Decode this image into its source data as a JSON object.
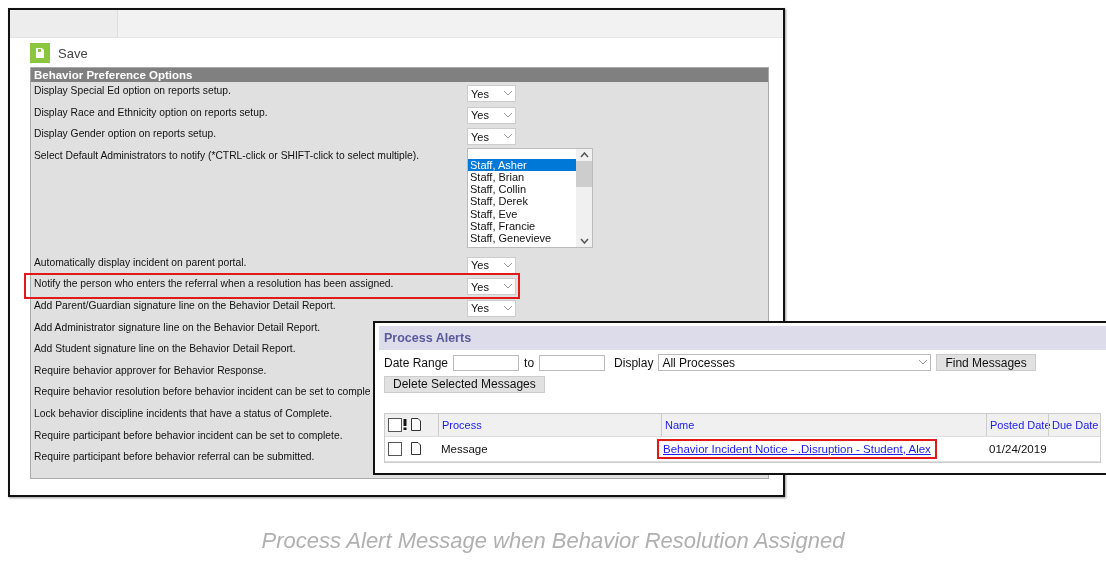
{
  "toolbar": {
    "save_label": "Save"
  },
  "panel": {
    "title": "Behavior Preference Options",
    "rows": [
      {
        "kind": "select",
        "label": "Display Special Ed option on reports setup.",
        "value": "Yes",
        "highlighted": false
      },
      {
        "kind": "select",
        "label": "Display Race and Ethnicity option on reports setup.",
        "value": "Yes",
        "highlighted": false
      },
      {
        "kind": "select",
        "label": "Display Gender option on reports setup.",
        "value": "Yes",
        "highlighted": false
      },
      {
        "kind": "listbox",
        "label": "Select Default Administrators to notify (*CTRL-click or SHIFT-click to select multiple).",
        "highlighted": false,
        "options": [
          {
            "label": "Staff, Asher",
            "selected": true
          },
          {
            "label": "Staff, Brian",
            "selected": false
          },
          {
            "label": "Staff, Collin",
            "selected": false
          },
          {
            "label": "Staff, Derek",
            "selected": false
          },
          {
            "label": "Staff, Eve",
            "selected": false
          },
          {
            "label": "Staff, Francie",
            "selected": false
          },
          {
            "label": "Staff, Genevieve",
            "selected": false
          }
        ]
      },
      {
        "kind": "select",
        "label": "Automatically display incident on parent portal.",
        "value": "Yes",
        "highlighted": false
      },
      {
        "kind": "select",
        "label": "Notify the person who enters the referral when a resolution has been assigned.",
        "value": "Yes",
        "highlighted": true
      },
      {
        "kind": "select",
        "label": "Add Parent/Guardian signature line on the Behavior Detail Report.",
        "value": "Yes",
        "highlighted": false
      },
      {
        "kind": "text",
        "label": "Add Administrator signature line on the Behavior Detail Report.",
        "highlighted": false
      },
      {
        "kind": "text",
        "label": "Add Student signature line on the Behavior Detail Report.",
        "highlighted": false
      },
      {
        "kind": "text",
        "label": "Require behavior approver for Behavior Response.",
        "highlighted": false
      },
      {
        "kind": "text",
        "label": "Require behavior resolution before behavior incident can be set to comple",
        "highlighted": false
      },
      {
        "kind": "text",
        "label": "Lock behavior discipline incidents that have a status of Complete.",
        "highlighted": false
      },
      {
        "kind": "text",
        "label": "Require participant before behavior incident can be set to complete.",
        "highlighted": false
      },
      {
        "kind": "text",
        "label": "Require participant before behavior referral can be submitted.",
        "highlighted": false
      }
    ]
  },
  "process_alerts": {
    "title": "Process Alerts",
    "date_range_label": "Date Range",
    "to_label": "to",
    "display_label": "Display",
    "display_value": "All Processes",
    "find_button": "Find Messages",
    "delete_button": "Delete Selected Messages",
    "select_all_checked": false,
    "columns": [
      "Process",
      "Name",
      "Posted Date",
      "Due Date"
    ],
    "rows": [
      {
        "checked": false,
        "process": "Message",
        "name": "Behavior Incident Notice - .Disruption - Student, Alex",
        "posted_date": "01/24/2019",
        "highlighted": true
      }
    ]
  },
  "caption": "Process Alert Message when Behavior Resolution Assigned"
}
